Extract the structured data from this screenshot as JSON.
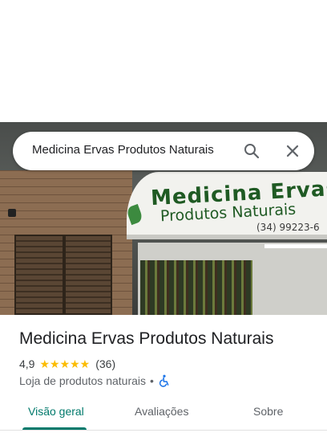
{
  "search": {
    "query": "Medicina Ervas Produtos Naturais",
    "search_icon": "search-icon",
    "close_icon": "close-icon"
  },
  "photo": {
    "sign_title": "Medicina Ervas",
    "sign_subtitle": "Produtos Naturais",
    "sign_phone": "(34) 99223-6"
  },
  "place": {
    "title": "Medicina Ervas Produtos Naturais",
    "rating": "4,9",
    "stars": "★★★★★",
    "review_count": "(36)",
    "category": "Loja de produtos naturais",
    "separator": "•",
    "accessibility_icon": "wheelchair-icon"
  },
  "tabs": [
    {
      "label": "Visão geral",
      "selected": true
    },
    {
      "label": "Avaliações",
      "selected": false
    },
    {
      "label": "Sobre",
      "selected": false
    }
  ],
  "colors": {
    "accent": "#00796b",
    "star": "#fbbc04",
    "sign_text": "#1f5a23"
  }
}
